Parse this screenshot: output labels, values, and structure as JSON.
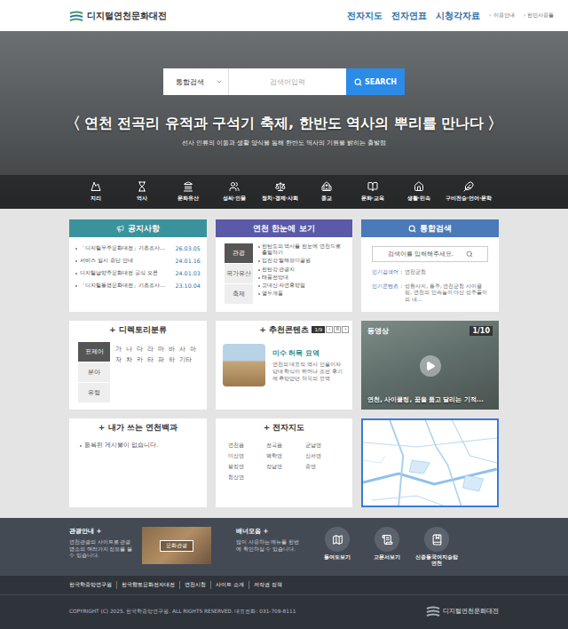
{
  "header": {
    "logo": "디지털연천문화대전",
    "nav": [
      "전자지도",
      "전자연표",
      "시청각자료"
    ],
    "util_marker": "›",
    "util": [
      "이용안내",
      "한민사용틀"
    ]
  },
  "hero": {
    "search": {
      "scope": "통합검색",
      "placeholder": "검색어입력",
      "button": "SEARCH"
    },
    "prev": "〈",
    "next": "〉",
    "headline": "연천 전곡리 유적과 구석기 축제, 한반도 역사의 뿌리를 만나다",
    "subtitle": "선사 인류의 이동과 생활 양식을 통해 한반도 역사의 기원을 밝히는 출발점"
  },
  "categories": [
    {
      "label": "지리"
    },
    {
      "label": "역사"
    },
    {
      "label": "문화유산"
    },
    {
      "label": "성씨·인물"
    },
    {
      "label": "정치·경제·사회"
    },
    {
      "label": "종교"
    },
    {
      "label": "문화·교육"
    },
    {
      "label": "생활·민속"
    },
    {
      "label": "구비전승·언어·문학"
    }
  ],
  "card_marker": "+",
  "notice": {
    "title": "공지사항",
    "items": [
      {
        "title": "「디지털무주문화대전」기초조사…",
        "date": "26.03.05"
      },
      {
        "title": "서비스 일시 중단 안내",
        "date": "24.01.16"
      },
      {
        "title": "디지털남양주문화대전 공식 오픈",
        "date": "24.01.03"
      },
      {
        "title": "「디지털통영문화대전」기초조사…",
        "date": "23.10.04"
      }
    ]
  },
  "glance": {
    "title": "연천 한눈에 보기",
    "tabs": [
      {
        "label": "관광",
        "selected": true
      },
      {
        "label": "국가유산",
        "selected": false
      },
      {
        "label": "축제",
        "selected": false
      }
    ],
    "items": [
      "한탄도의 역사를 한눈에 연천으로 출발하기",
      "임진강 발해보미끝원",
      "한탄강 관광지",
      "태풍전망대",
      "고대산 자연휴양림",
      "열두개울"
    ]
  },
  "search_card": {
    "title": "통합검색",
    "placeholder": "검색어를 입력해주세요.",
    "separator": ":",
    "popular": [
      {
        "label": "인기검색어",
        "value": "연천군청"
      },
      {
        "label": "인기콘텐츠",
        "value": "성황사지, 통주, 연천군청 사이클링, 연천의 민속놀이 마산 성주풀이의 내…"
      }
    ]
  },
  "directory": {
    "title": "디렉토리분류",
    "tabs": [
      {
        "label": "표제어",
        "selected": true
      },
      {
        "label": "분야",
        "selected": false
      },
      {
        "label": "유형",
        "selected": false
      }
    ],
    "letters": [
      "가",
      "나",
      "다",
      "라",
      "마",
      "바",
      "사",
      "아",
      "자",
      "차",
      "카",
      "타",
      "파",
      "하",
      "기타"
    ]
  },
  "recommend": {
    "title": "추천콘텐츠",
    "page": "1/9",
    "controls": [
      "‹",
      "II",
      "›"
    ],
    "item": {
      "title": "미수 허목 묘역",
      "text": "연천의 대표적 역사 인물이자 당대 학식이 뛰어나 조선 후기에 추앙받던 허목의 묘역"
    }
  },
  "video": {
    "label": "동영상",
    "page": "1/10",
    "caption": "연천, 사이클링, 꿈을 품고 달리는 기적..."
  },
  "mybook": {
    "title": "내가 쓰는 연천백과",
    "empty": "등록된 게시물이 없습니다."
  },
  "emap": {
    "title": "전자지도",
    "towns": [
      "연천읍",
      "전곡읍",
      "군남면",
      "미산면",
      "백학면",
      "신서면",
      "왕징면",
      "장남면",
      "중면",
      "청산면"
    ]
  },
  "tour": {
    "title": "관광안내",
    "text": "연천관광의 사이트로 관광명소의 여러가지 정보를 볼 수 있습니다.",
    "button": "문화관광"
  },
  "banners": {
    "title": "배너모음",
    "text": "많이 사용하는 메뉴를 한번에 확인하실 수 있습니다.",
    "items": [
      "동여도보기",
      "고문서보기",
      "신증동국여지승람 연천"
    ]
  },
  "footer": {
    "links": [
      "한국학중앙연구원",
      "한국향토문화전자대전",
      "연천시청",
      "사이트 소개",
      "저작권 정책"
    ],
    "copyright": "COPYRIGHT (C) 2025. 한국학중앙연구원. ALL RIGHTS RESERVED. 대표전화: 031-709-8111",
    "logo": "디지털연천문화대전"
  }
}
